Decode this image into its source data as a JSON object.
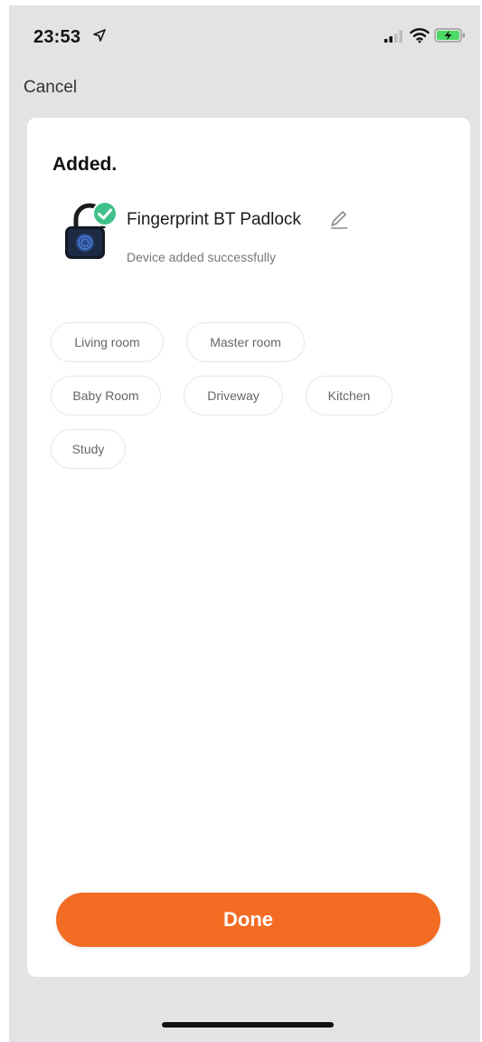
{
  "status_bar": {
    "time": "23:53",
    "icons": [
      "location-arrow-icon",
      "cellular-signal-icon",
      "wifi-icon",
      "battery-charging-icon"
    ],
    "battery_color": "#4cd964"
  },
  "nav": {
    "cancel_label": "Cancel"
  },
  "card": {
    "title": "Added.",
    "device": {
      "name": "Fingerprint BT Padlock",
      "status": "Device added successfully",
      "icon": "padlock-device-icon",
      "badge_icon": "check-badge-icon",
      "badge_color": "#3ec28a"
    },
    "rooms": [
      {
        "label": "Living room"
      },
      {
        "label": "Master room"
      },
      {
        "label": "Baby Room"
      },
      {
        "label": "Driveway"
      },
      {
        "label": "Kitchen"
      },
      {
        "label": "Study"
      }
    ]
  },
  "actions": {
    "done_label": "Done",
    "accent_color": "#f36c24"
  }
}
